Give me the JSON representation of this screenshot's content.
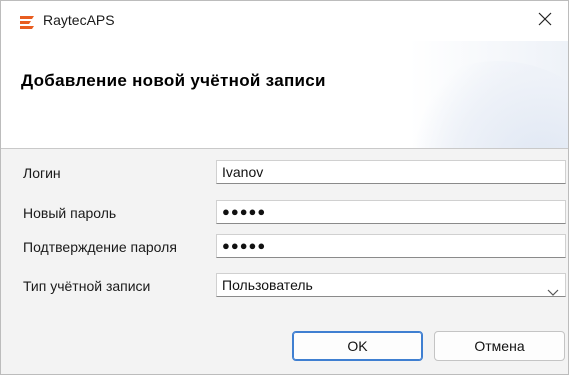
{
  "window": {
    "title": "RaytecAPS",
    "close_glyph": "✕",
    "logo_icon": "raytec-logo-icon",
    "close_icon": "close-icon"
  },
  "header": {
    "title": "Добавление новой учётной записи"
  },
  "form": {
    "login": {
      "label": "Логин",
      "value": "Ivanov"
    },
    "new_password": {
      "label": "Новый пароль",
      "value": "●●●●●"
    },
    "confirm_password": {
      "label": "Подтверждение пароля",
      "value": "●●●●●"
    },
    "account_type": {
      "label": "Тип учётной записи",
      "value": "Пользователь",
      "icon": "chevron-down-icon"
    }
  },
  "buttons": {
    "ok": "OK",
    "cancel": "Отмена"
  },
  "colors": {
    "logo": "#e85d20",
    "ok_border": "#3f7fd1"
  }
}
